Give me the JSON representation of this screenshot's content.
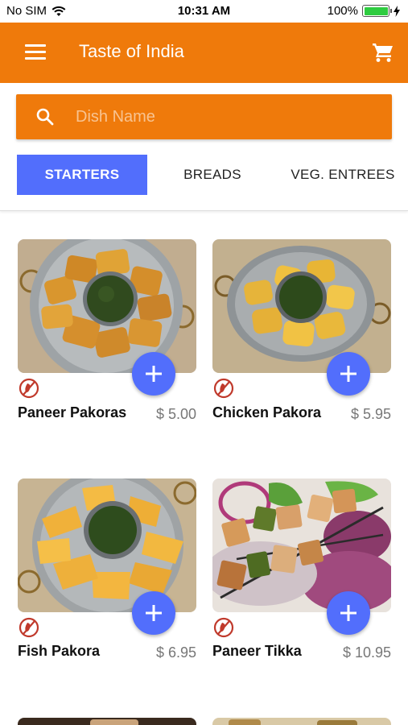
{
  "status_bar": {
    "carrier": "No SIM",
    "time": "10:31 AM",
    "battery": "100%",
    "battery_level": 1.0
  },
  "app_bar": {
    "title": "Taste of India",
    "menu_icon": "hamburger-menu-icon",
    "cart_icon": "shopping-cart-icon"
  },
  "search": {
    "placeholder": "Dish Name",
    "value": "",
    "icon": "search-icon"
  },
  "tabs": [
    {
      "label": "STARTERS",
      "active": true
    },
    {
      "label": "BREADS",
      "active": false
    },
    {
      "label": "VEG. ENTREES",
      "active": false
    }
  ],
  "dishes": [
    {
      "name": "Paneer Pakoras",
      "price": "$ 5.00"
    },
    {
      "name": "Chicken Pakora",
      "price": "$ 5.95"
    },
    {
      "name": "Fish Pakora",
      "price": "$ 6.95"
    },
    {
      "name": "Paneer Tikka",
      "price": "$ 10.95"
    }
  ],
  "colors": {
    "primary": "#ef7a0b",
    "accent": "#526efc",
    "price": "#777777",
    "no-veg-icon": "#c0392b"
  }
}
